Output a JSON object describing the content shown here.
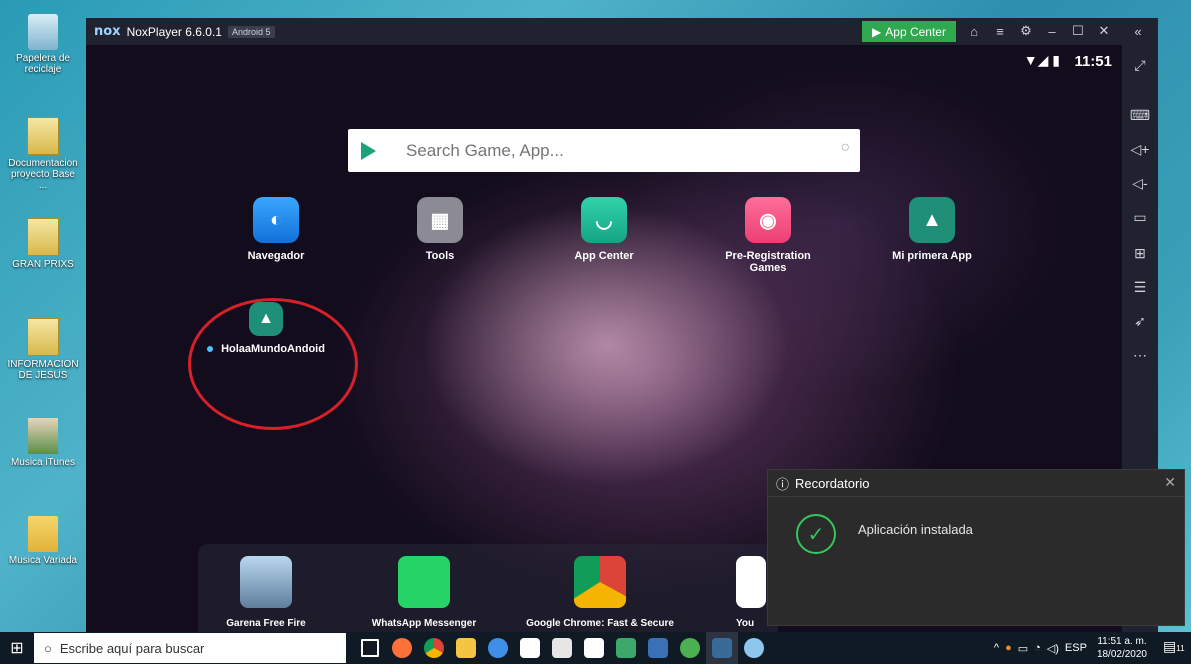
{
  "desktop": {
    "icons": [
      {
        "label": "Papelera de reciclaje"
      },
      {
        "label": "Documentacion proyecto Base ..."
      },
      {
        "label": "GRAN PRIXS"
      },
      {
        "label": "INFORMACION DE JESUS"
      },
      {
        "label": "Musica iTunes"
      },
      {
        "label": "Musica Variada"
      }
    ]
  },
  "nox": {
    "logo": "nox",
    "title": "NoxPlayer 6.6.0.1",
    "android_badge": "Android 5",
    "app_center_button": "App Center"
  },
  "android": {
    "time": "11:51",
    "search_placeholder": "Search Game, App...",
    "apps": [
      {
        "label": "Navegador"
      },
      {
        "label": "Tools"
      },
      {
        "label": "App Center"
      },
      {
        "label": "Pre-Registration Games"
      },
      {
        "label": "Mi primera App"
      },
      {
        "label": "HolaaMundoAndoid"
      }
    ],
    "dock": [
      {
        "label": "Garena Free Fire"
      },
      {
        "label": "WhatsApp Messenger"
      },
      {
        "label": "Google Chrome: Fast & Secure"
      },
      {
        "label": "You"
      }
    ]
  },
  "toast": {
    "title": "Recordatorio",
    "message": "Aplicación instalada"
  },
  "taskbar": {
    "search_placeholder": "Escribe aquí para buscar",
    "language": "ESP",
    "time": "11:51 a. m.",
    "date": "18/02/2020",
    "notifications": "11"
  }
}
